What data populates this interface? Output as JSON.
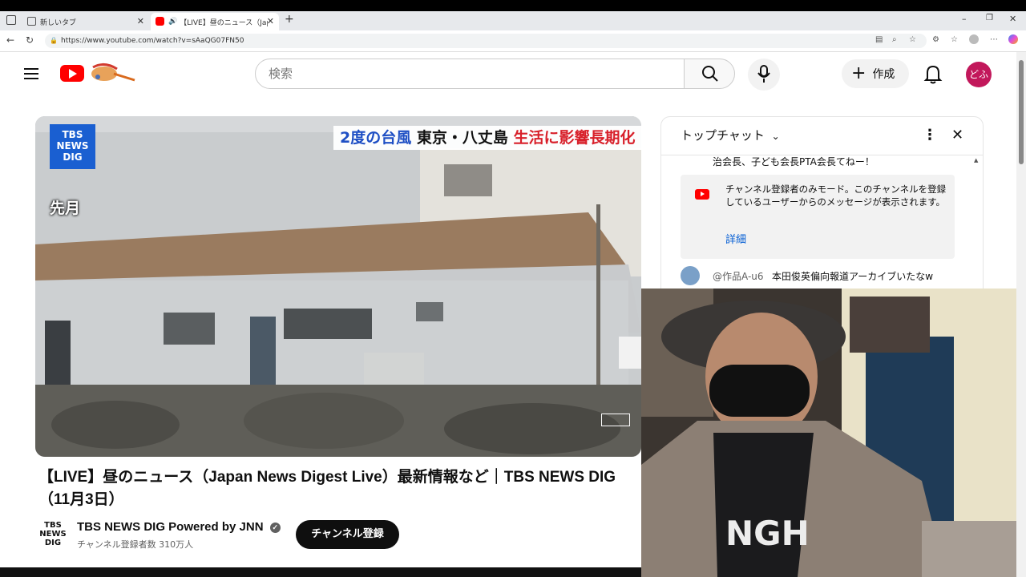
{
  "browser": {
    "tabs": [
      {
        "label": "新しいタブ"
      },
      {
        "label": "【LIVE】昼のニュース（Japan Ne"
      }
    ],
    "url": "https://www.youtube.com/watch?v=sAaQG07FN50"
  },
  "header": {
    "search_placeholder": "検索",
    "create_label": "作成",
    "avatar_text": "どふ"
  },
  "video": {
    "overlay_logo_lines": [
      "TBS",
      "NEWS",
      "DIG"
    ],
    "caption_part1": "2度の台風",
    "caption_part2": "東京・八丈島",
    "caption_part3": "生活に影響長期化",
    "side_caption": "先月",
    "title": "【LIVE】昼のニュース（Japan News Digest Live）最新情報など｜TBS NEWS DIG（11月3日）"
  },
  "channel": {
    "logo_lines": [
      "TBS",
      "NEWS",
      "DIG"
    ],
    "name": "TBS NEWS DIG Powered by JNN",
    "subscribers": "チャンネル登録者数 310万人",
    "subscribe_label": "チャンネル登録"
  },
  "chat": {
    "title": "トップチャット",
    "prev_message": "治会長、子ども会長PTA会長てねー！",
    "notice": "チャンネル登録者のみモード。このチャンネルを登録しているユーザーからのメッセージが表示されます。",
    "notice_link": "詳細",
    "message_author": "@作品A-u6",
    "message_text": "本田俊英偏向報道アーカイブいたなw"
  },
  "colors": {
    "youtube_red": "#ff0000",
    "link_blue": "#065fd4",
    "avatar_bg": "#c2185b"
  }
}
